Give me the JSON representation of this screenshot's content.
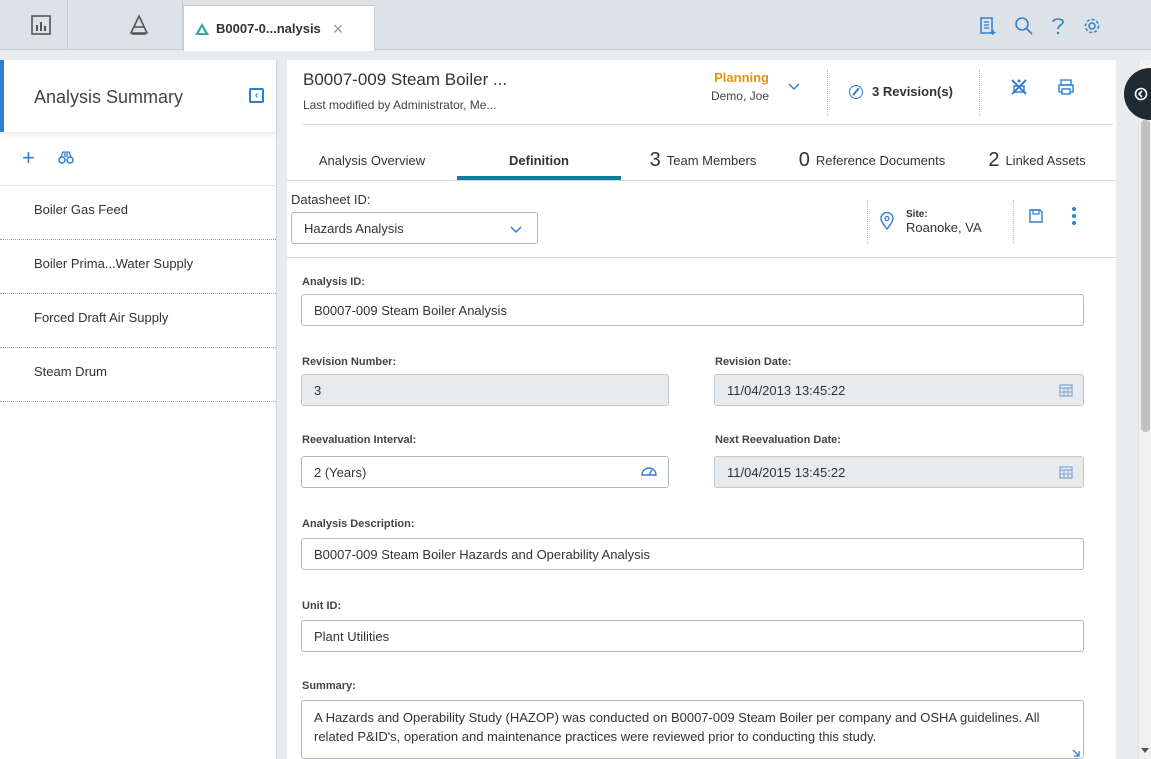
{
  "topbar": {
    "tab_title": "B0007-0...nalysis",
    "icons": [
      "dashboard-icon",
      "hazard-analysis-icon",
      "add-note-icon",
      "search-icon",
      "help-icon",
      "settings-icon"
    ]
  },
  "sidebar": {
    "title": "Analysis Summary",
    "items": [
      {
        "label": "Boiler Gas Feed"
      },
      {
        "label": "Boiler Prima...Water Supply"
      },
      {
        "label": "Forced Draft Air Supply"
      },
      {
        "label": "Steam Drum"
      }
    ]
  },
  "header": {
    "title": "B0007-009 Steam Boiler ...",
    "subtitle": "Last modified by Administrator, Me...",
    "state": "Planning",
    "state_user": "Demo, Joe",
    "revisions": "3 Revision(s)"
  },
  "tabs": [
    {
      "count": "",
      "label": "Analysis Overview"
    },
    {
      "count": "",
      "label": "Definition"
    },
    {
      "count": "3",
      "label": "Team Members"
    },
    {
      "count": "0",
      "label": "Reference Documents"
    },
    {
      "count": "2",
      "label": "Linked Assets"
    }
  ],
  "datasheet": {
    "label": "Datasheet ID:",
    "value": "Hazards Analysis",
    "site_label": "Site:",
    "site_value": "Roanoke, VA"
  },
  "form": {
    "analysis_id": {
      "label": "Analysis ID:",
      "value": "B0007-009 Steam Boiler Analysis"
    },
    "revision_number": {
      "label": "Revision Number:",
      "value": "3"
    },
    "revision_date": {
      "label": "Revision Date:",
      "value": "11/04/2013 13:45:22"
    },
    "reevaluation_interval": {
      "label": "Reevaluation Interval:",
      "value": "2 (Years)"
    },
    "next_reevaluation_date": {
      "label": "Next Reevaluation Date:",
      "value": "11/04/2015 13:45:22"
    },
    "analysis_description": {
      "label": "Analysis Description:",
      "value": "B0007-009 Steam Boiler Hazards and Operability Analysis"
    },
    "unit_id": {
      "label": "Unit ID:",
      "value": "Plant Utilities"
    },
    "summary": {
      "label": "Summary:",
      "value": "A Hazards and Operability Study (HAZOP) was conducted on B0007-009 Steam Boiler per company and OSHA guidelines. All related P&ID's, operation and maintenance practices were reviewed prior to conducting this study."
    }
  },
  "colors": {
    "accent": "#2f7fd1",
    "active_tab_underline": "#137b9e",
    "state_planning": "#e8930c"
  }
}
